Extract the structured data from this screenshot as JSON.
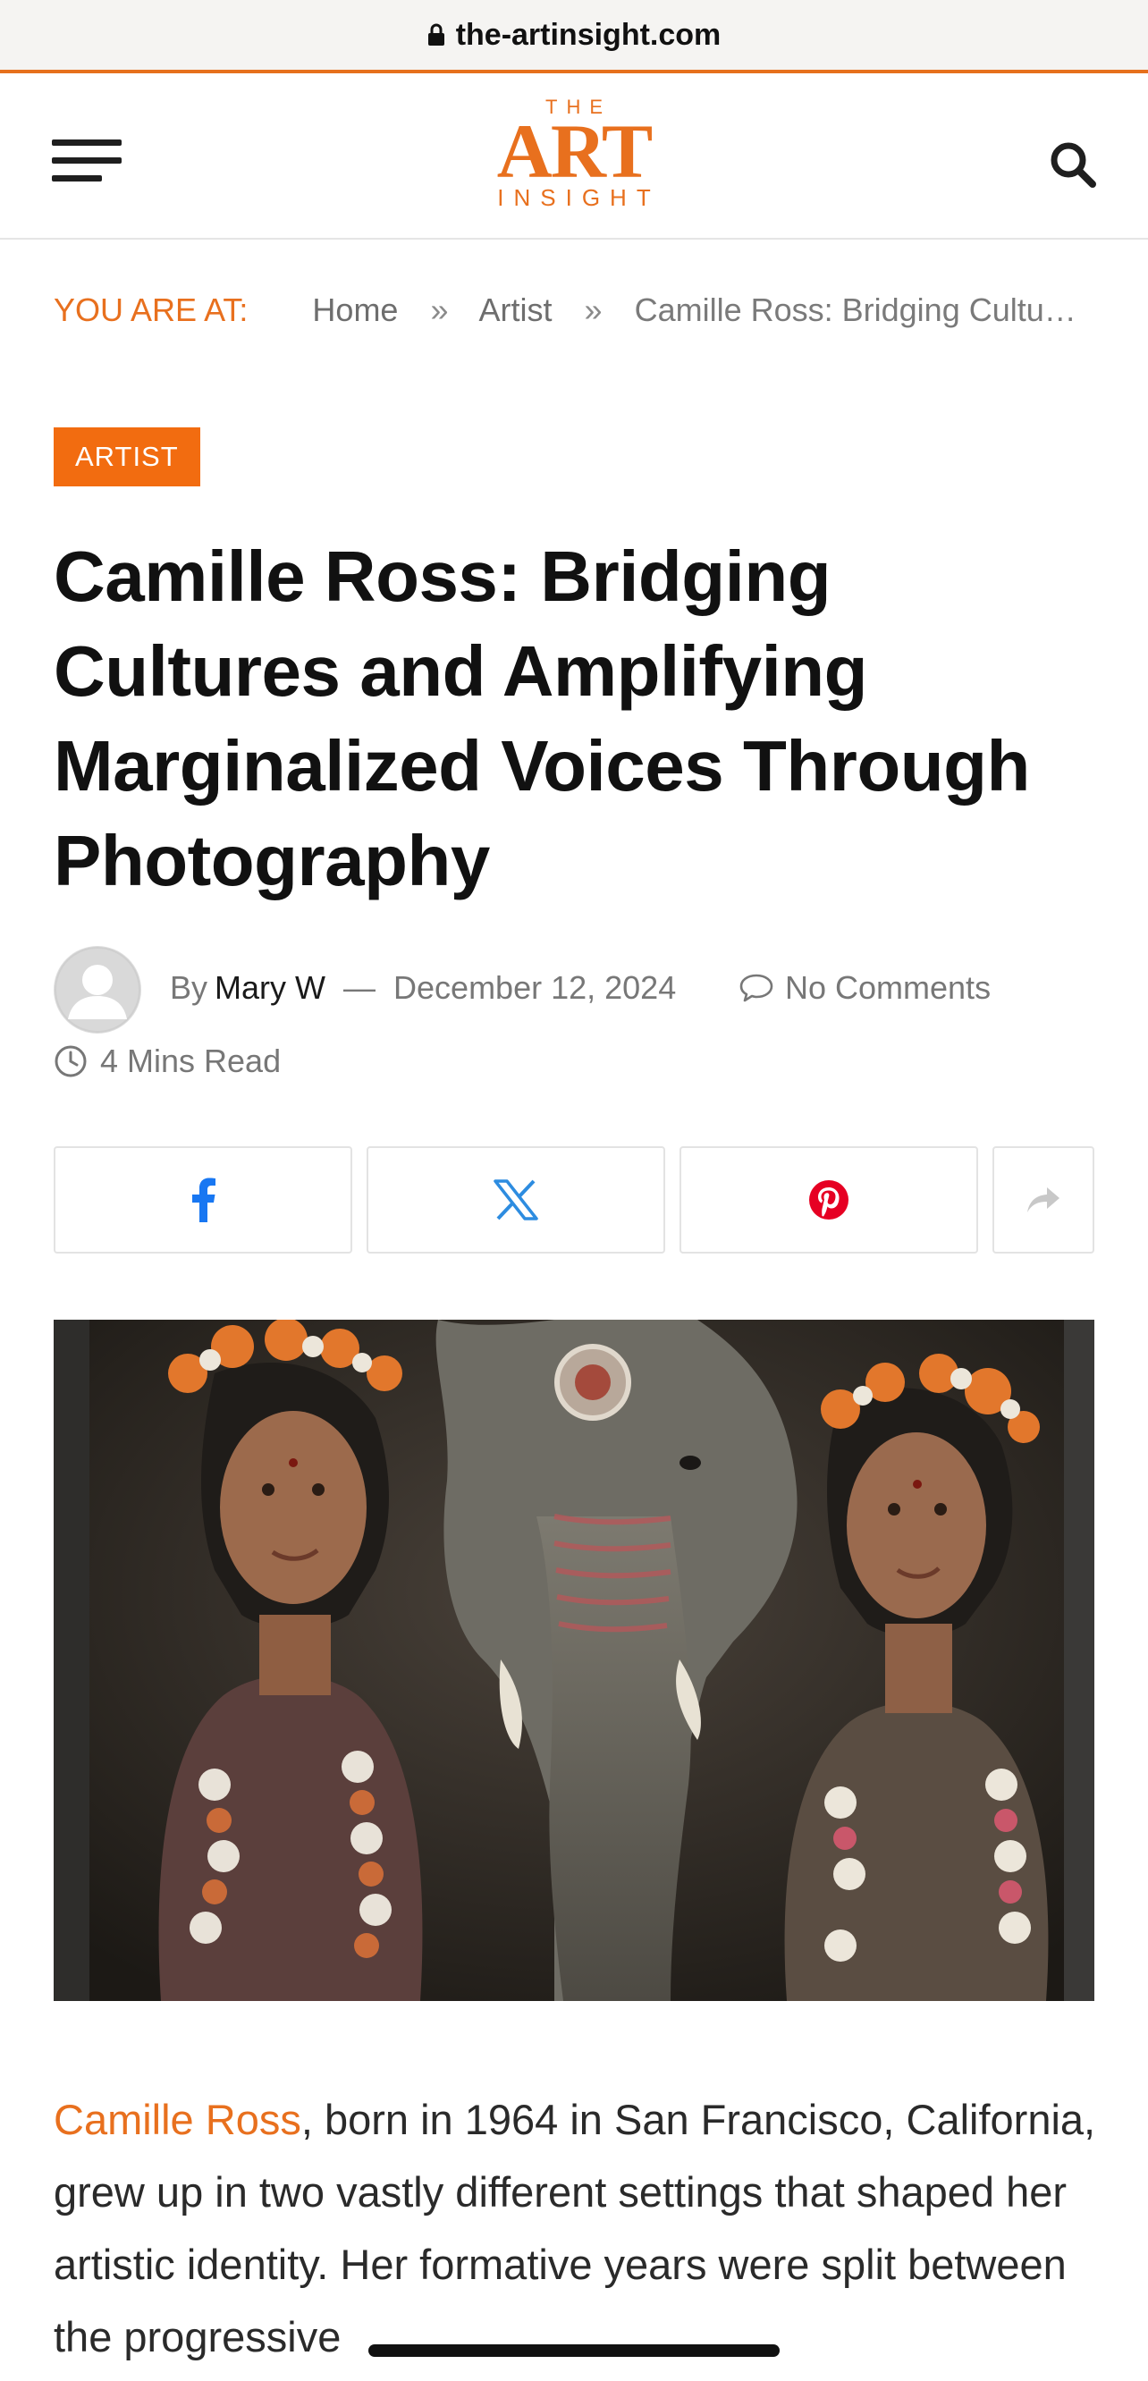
{
  "browser": {
    "url": "the-artinsight.com"
  },
  "site": {
    "logo": {
      "the": "THE",
      "art": "ART",
      "insight": "INSIGHT"
    },
    "brand_color": "#e8701e"
  },
  "breadcrumb": {
    "lead": "YOU ARE AT:",
    "items": [
      "Home",
      "Artist",
      "Camille Ross: Bridging Cultu…"
    ],
    "separator": "»"
  },
  "article": {
    "category": "ARTIST",
    "title": "Camille Ross: Bridging Cultures and Amplifying Marginalized Voices Through Photography",
    "by": "By",
    "author": "Mary W",
    "dash": "—",
    "date": "December 12, 2024",
    "comments": "No Comments",
    "read_time": "4 Mins Read",
    "share": [
      {
        "network": "facebook",
        "icon": "facebook-icon",
        "color": "#1877f2"
      },
      {
        "network": "x",
        "icon": "x-icon",
        "color": "#2d8ce0"
      },
      {
        "network": "pinterest",
        "icon": "pinterest-icon",
        "color": "#e60023"
      },
      {
        "network": "more",
        "icon": "share-icon",
        "color": "#c8c8c8"
      }
    ],
    "body_link": "Camille Ross",
    "body_text": ", born in 1964 in San Francisco, California, grew up in two vastly different settings that shaped her artistic identity. Her formative years were split between the progressive"
  }
}
